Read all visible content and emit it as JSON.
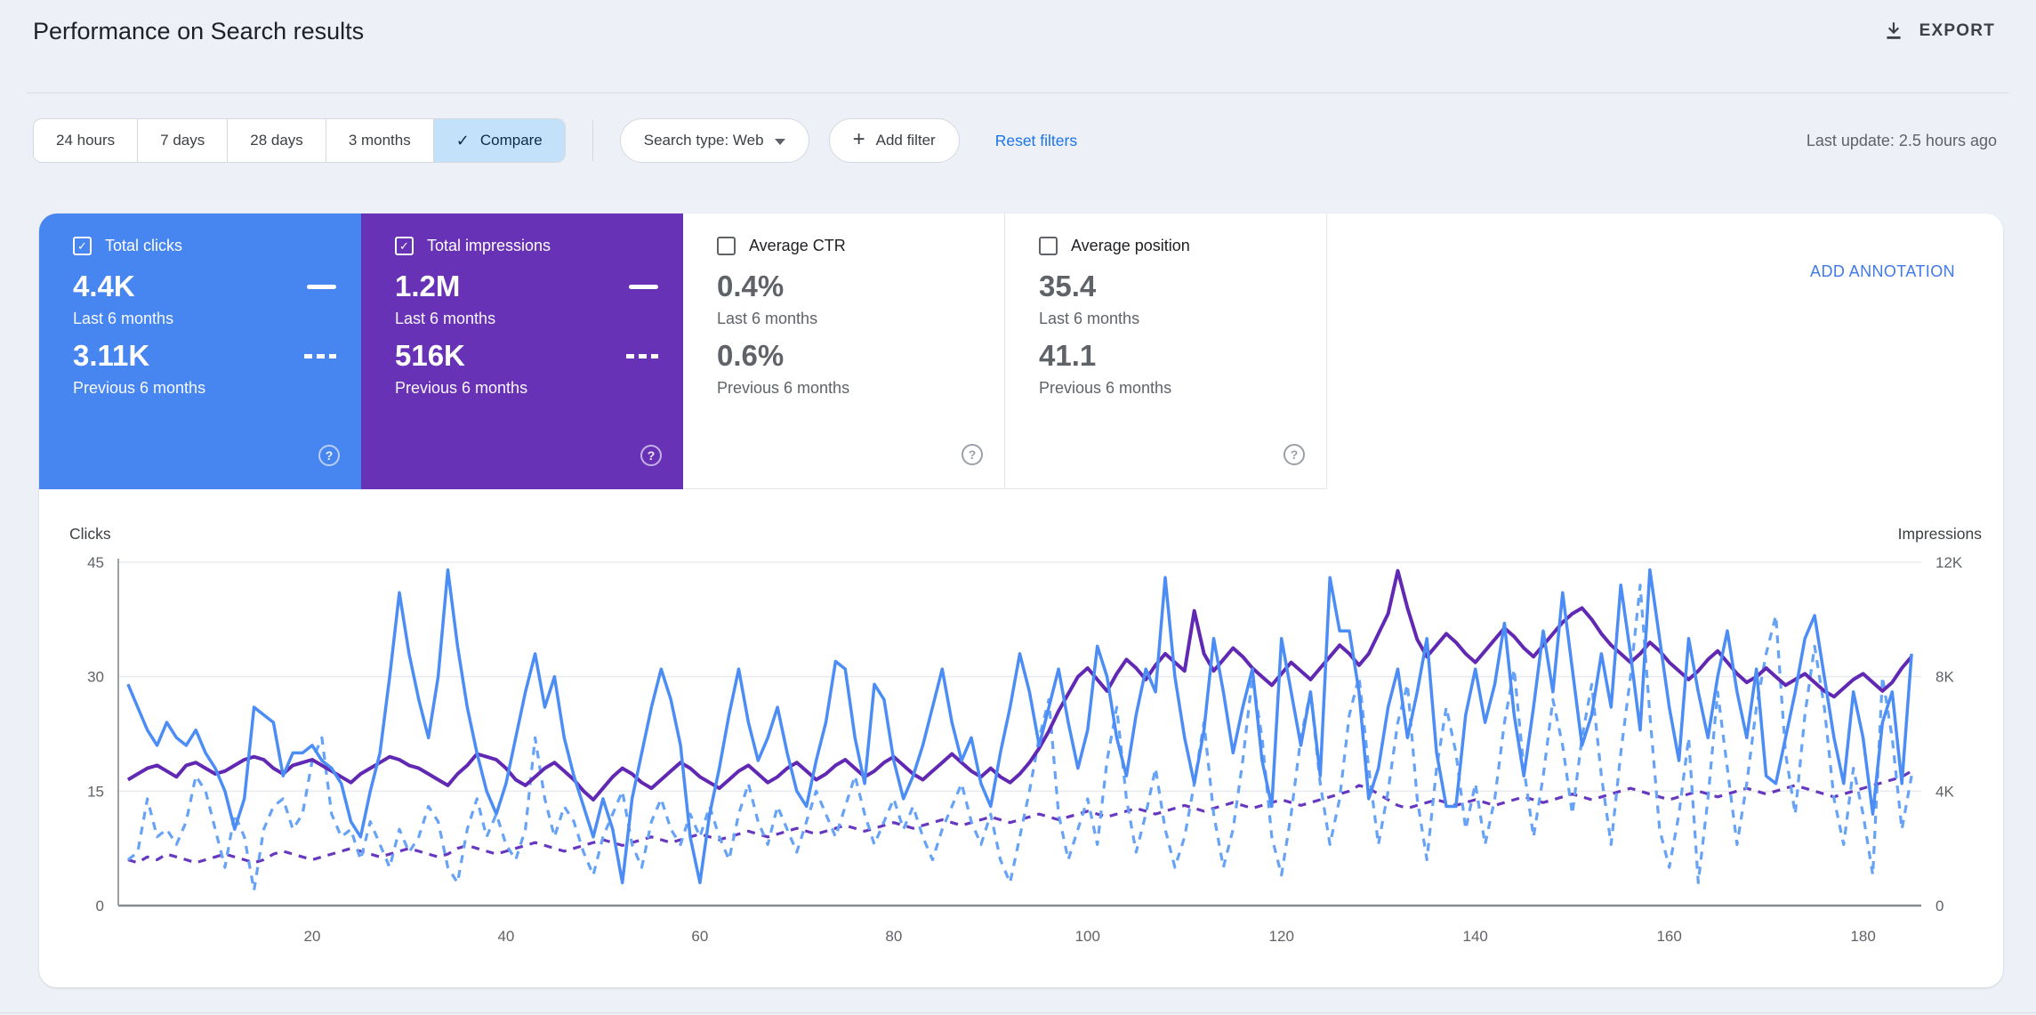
{
  "header": {
    "title": "Performance on Search results",
    "export_label": "EXPORT"
  },
  "toolbar": {
    "date_ranges": [
      {
        "label": "24 hours",
        "selected": false
      },
      {
        "label": "7 days",
        "selected": false
      },
      {
        "label": "28 days",
        "selected": false
      },
      {
        "label": "3 months",
        "selected": false
      },
      {
        "label": "Compare",
        "selected": true
      }
    ],
    "search_type_label": "Search type: Web",
    "add_filter_label": "Add filter",
    "reset_filters_label": "Reset filters",
    "last_update": "Last update: 2.5 hours ago"
  },
  "metrics": [
    {
      "id": "total-clicks",
      "label": "Total clicks",
      "checked": true,
      "color": "#4785f0",
      "rows": [
        {
          "value": "4.4K",
          "caption": "Last 6 months",
          "marker": "solid"
        },
        {
          "value": "3.11K",
          "caption": "Previous 6 months",
          "marker": "dashed"
        }
      ]
    },
    {
      "id": "total-impressions",
      "label": "Total impressions",
      "checked": true,
      "color": "#6732b5",
      "rows": [
        {
          "value": "1.2M",
          "caption": "Last 6 months",
          "marker": "solid"
        },
        {
          "value": "516K",
          "caption": "Previous 6 months",
          "marker": "dashed"
        }
      ]
    },
    {
      "id": "average-ctr",
      "label": "Average CTR",
      "checked": false,
      "color": "",
      "rows": [
        {
          "value": "0.4%",
          "caption": "Last 6 months",
          "marker": ""
        },
        {
          "value": "0.6%",
          "caption": "Previous 6 months",
          "marker": ""
        }
      ]
    },
    {
      "id": "average-position",
      "label": "Average position",
      "checked": false,
      "color": "",
      "rows": [
        {
          "value": "35.4",
          "caption": "Last 6 months",
          "marker": ""
        },
        {
          "value": "41.1",
          "caption": "Previous 6 months",
          "marker": ""
        }
      ]
    }
  ],
  "annotation_label": "ADD ANNOTATION",
  "icons": {
    "check": "✓",
    "help": "?"
  },
  "colors": {
    "compare_bg": "#c3e1f9",
    "compare_text": "#0c2d48",
    "link_blue": "#1a73e8",
    "annotation_blue": "#4079e9",
    "clicks_blue": "#4785f0",
    "impressions_purple": "#6732b5",
    "grid": "#e8eaed",
    "axis": "#848a90",
    "tick_text": "#5f6368"
  },
  "chart_data": {
    "type": "line",
    "grid": "horizontal",
    "left_axis": {
      "title": "Clicks",
      "max": 45,
      "ticks": [
        0,
        15,
        30,
        45
      ]
    },
    "right_axis": {
      "title": "Impressions",
      "max": 12000,
      "ticks": [
        "0",
        "4K",
        "8K",
        "12K"
      ]
    },
    "x_axis": {
      "range": [
        1,
        185
      ],
      "ticks": [
        20,
        40,
        60,
        80,
        100,
        120,
        140,
        160,
        180
      ]
    },
    "series": [
      {
        "name": "Clicks - Last 6 months",
        "axis": "left",
        "style": "solid",
        "color": "#4c8df5",
        "values": [
          29,
          26,
          23,
          21,
          24,
          22,
          21,
          23,
          20,
          18,
          15,
          10,
          14,
          26,
          25,
          24,
          17,
          20,
          20,
          21,
          19,
          18,
          16,
          11,
          9,
          15,
          20,
          30,
          41,
          33,
          27,
          22,
          30,
          44,
          34,
          26,
          20,
          15,
          12,
          16,
          22,
          28,
          33,
          26,
          30,
          22,
          17,
          13,
          9,
          14,
          10,
          3,
          14,
          20,
          26,
          31,
          27,
          21,
          9,
          3,
          12,
          18,
          25,
          31,
          24,
          19,
          22,
          26,
          20,
          15,
          13,
          19,
          24,
          32,
          31,
          22,
          16,
          29,
          27,
          19,
          14,
          17,
          21,
          26,
          31,
          24,
          19,
          22,
          16,
          13,
          20,
          26,
          33,
          28,
          21,
          26,
          31,
          24,
          18,
          23,
          34,
          30,
          22,
          17,
          25,
          31,
          28,
          43,
          30,
          22,
          16,
          23,
          35,
          28,
          20,
          26,
          31,
          19,
          13,
          35,
          28,
          21,
          28,
          17,
          43,
          36,
          36,
          28,
          14,
          18,
          26,
          31,
          22,
          28,
          35,
          20,
          13,
          13,
          25,
          31,
          24,
          29,
          37,
          25,
          17,
          26,
          36,
          28,
          41,
          31,
          21,
          25,
          33,
          26,
          42,
          33,
          23,
          44,
          35,
          26,
          19,
          35,
          28,
          22,
          30,
          36,
          28,
          22,
          31,
          17,
          16,
          22,
          28,
          35,
          38,
          30,
          22,
          16,
          28,
          22,
          12,
          24,
          28,
          16,
          33
        ]
      },
      {
        "name": "Clicks - Previous 6 months",
        "axis": "left",
        "style": "dashed",
        "color": "#66a2f6",
        "values": [
          6,
          7,
          14,
          9,
          10,
          8,
          11,
          17,
          15,
          10,
          5,
          12,
          9,
          2,
          10,
          13,
          14,
          10,
          12,
          19,
          22,
          12,
          9,
          10,
          6,
          11,
          8,
          5,
          10,
          7,
          9,
          13,
          11,
          5,
          3,
          10,
          14,
          9,
          12,
          8,
          6,
          10,
          22,
          14,
          9,
          13,
          11,
          7,
          4,
          9,
          12,
          15,
          8,
          5,
          11,
          14,
          10,
          8,
          12,
          9,
          13,
          9,
          6,
          12,
          16,
          11,
          8,
          13,
          10,
          7,
          11,
          15,
          12,
          9,
          13,
          17,
          12,
          8,
          11,
          14,
          10,
          13,
          9,
          6,
          10,
          13,
          16,
          11,
          8,
          12,
          6,
          3,
          9,
          15,
          22,
          27,
          12,
          6,
          10,
          14,
          8,
          19,
          26,
          14,
          7,
          12,
          18,
          10,
          5,
          9,
          16,
          24,
          12,
          5,
          10,
          19,
          30,
          22,
          9,
          4,
          12,
          22,
          28,
          16,
          8,
          14,
          25,
          30,
          18,
          8,
          15,
          24,
          29,
          14,
          6,
          18,
          26,
          20,
          10,
          16,
          8,
          14,
          24,
          31,
          18,
          9,
          17,
          27,
          21,
          12,
          22,
          29,
          17,
          8,
          20,
          30,
          42,
          25,
          10,
          5,
          12,
          22,
          3,
          14,
          28,
          18,
          8,
          16,
          26,
          33,
          38,
          20,
          12,
          25,
          34,
          26,
          14,
          8,
          18,
          12,
          4,
          30,
          22,
          10,
          17
        ]
      },
      {
        "name": "Impressions - Last 6 months",
        "axis": "right",
        "style": "solid",
        "color": "#6129b3",
        "values": [
          4400,
          4600,
          4800,
          4900,
          4700,
          4500,
          4900,
          5000,
          4800,
          4600,
          4700,
          4900,
          5100,
          5200,
          5100,
          4800,
          4600,
          4900,
          5000,
          5100,
          4900,
          4700,
          4500,
          4300,
          4600,
          4800,
          5000,
          5200,
          5100,
          4900,
          4800,
          4600,
          4400,
          4200,
          4600,
          4900,
          5300,
          5200,
          5100,
          4800,
          4400,
          4200,
          4500,
          4800,
          5000,
          4700,
          4400,
          4000,
          3700,
          4100,
          4500,
          4800,
          4600,
          4300,
          4100,
          4400,
          4700,
          5000,
          4800,
          4500,
          4300,
          4100,
          4400,
          4700,
          4900,
          4600,
          4300,
          4500,
          4800,
          5000,
          4700,
          4400,
          4600,
          4900,
          5100,
          4800,
          4500,
          4700,
          5000,
          5200,
          4900,
          4600,
          4400,
          4700,
          5000,
          5300,
          5000,
          4700,
          4500,
          4800,
          4500,
          4300,
          4600,
          5000,
          5500,
          6100,
          6800,
          7400,
          8000,
          8300,
          7900,
          7500,
          8100,
          8600,
          8300,
          7900,
          8400,
          8800,
          8500,
          8200,
          10300,
          8800,
          8200,
          8600,
          9000,
          8700,
          8300,
          8000,
          7700,
          8100,
          8500,
          8200,
          7900,
          8300,
          8700,
          9100,
          8800,
          8400,
          8800,
          9500,
          10200,
          11700,
          10400,
          9300,
          8700,
          9100,
          9500,
          9200,
          8800,
          8500,
          8900,
          9300,
          9700,
          9400,
          9000,
          8700,
          9100,
          9500,
          9900,
          10200,
          10400,
          10000,
          9500,
          9100,
          8800,
          8500,
          8800,
          9200,
          8900,
          8500,
          8200,
          7900,
          8200,
          8600,
          8900,
          8500,
          8100,
          7800,
          8000,
          8300,
          8000,
          7700,
          7900,
          8100,
          7800,
          7500,
          7300,
          7600,
          7900,
          8100,
          7800,
          7500,
          7800,
          8300,
          8700
        ]
      },
      {
        "name": "Impressions - Previous 6 months",
        "axis": "right",
        "style": "dashed",
        "color": "#6638c0",
        "values": [
          1600,
          1500,
          1700,
          1600,
          1800,
          1700,
          1600,
          1500,
          1600,
          1700,
          1800,
          1700,
          1600,
          1500,
          1600,
          1800,
          1900,
          1800,
          1700,
          1600,
          1700,
          1800,
          1900,
          2000,
          1900,
          1800,
          1700,
          1800,
          1900,
          2000,
          1900,
          1800,
          1700,
          1800,
          2000,
          2100,
          2000,
          1900,
          1800,
          1900,
          2000,
          2100,
          2200,
          2100,
          2000,
          1900,
          2000,
          2100,
          2200,
          2300,
          2200,
          2100,
          2200,
          2300,
          2400,
          2300,
          2200,
          2300,
          2400,
          2500,
          2400,
          2300,
          2400,
          2500,
          2600,
          2500,
          2400,
          2500,
          2600,
          2700,
          2600,
          2500,
          2600,
          2700,
          2800,
          2700,
          2600,
          2700,
          2800,
          2900,
          2800,
          2700,
          2800,
          2900,
          3000,
          2900,
          2800,
          2900,
          3000,
          3100,
          3000,
          2900,
          3000,
          3100,
          3200,
          3100,
          3000,
          3100,
          3200,
          3300,
          3200,
          3100,
          3200,
          3300,
          3400,
          3300,
          3200,
          3300,
          3400,
          3500,
          3400,
          3300,
          3400,
          3500,
          3600,
          3500,
          3400,
          3500,
          3600,
          3700,
          3600,
          3500,
          3600,
          3700,
          3800,
          3900,
          4000,
          4200,
          4100,
          3900,
          3700,
          3500,
          3400,
          3500,
          3600,
          3700,
          3600,
          3500,
          3600,
          3700,
          3600,
          3500,
          3600,
          3700,
          3800,
          3700,
          3600,
          3700,
          3800,
          3900,
          3800,
          3700,
          3800,
          3900,
          4000,
          4100,
          4000,
          3900,
          3800,
          3700,
          3800,
          3900,
          4000,
          3900,
          3800,
          3900,
          4000,
          4100,
          4000,
          3900,
          4000,
          4100,
          4200,
          4100,
          4000,
          3900,
          3800,
          3900,
          4000,
          4100,
          4200,
          4300,
          4400,
          4500,
          4700
        ]
      }
    ]
  }
}
